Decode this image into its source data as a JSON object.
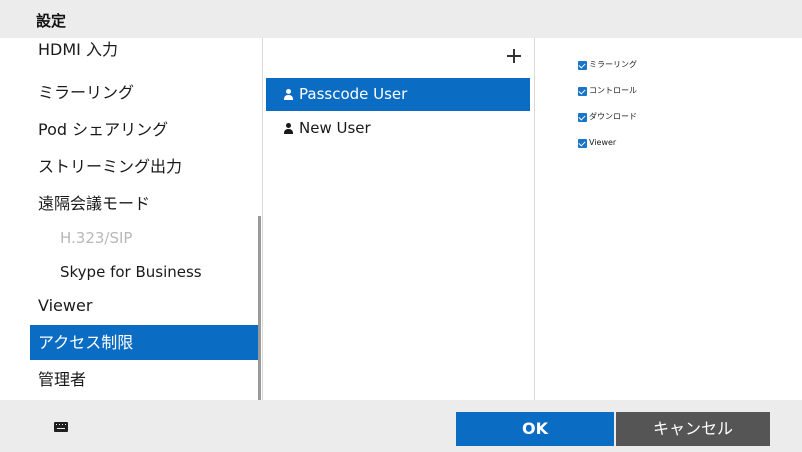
{
  "window": {
    "title": "設定"
  },
  "menu": {
    "items": [
      {
        "label": "HDMI 入力",
        "state": "normal"
      },
      {
        "label": "ミラーリング",
        "state": "normal"
      },
      {
        "label": "Pod シェアリング",
        "state": "normal"
      },
      {
        "label": "ストリーミング出力",
        "state": "normal"
      },
      {
        "label": "遠隔会議モード",
        "state": "normal"
      },
      {
        "label": "H.323/SIP",
        "state": "disabled"
      },
      {
        "label": "Skype for Business",
        "state": "sub"
      },
      {
        "label": "Viewer",
        "state": "normal"
      },
      {
        "label": "アクセス制限",
        "state": "selected"
      },
      {
        "label": "管理者",
        "state": "normal"
      }
    ]
  },
  "users": {
    "add_icon": "plus-icon",
    "items": [
      {
        "label": "Passcode User",
        "selected": true,
        "icon": "person-icon"
      },
      {
        "label": "New User",
        "selected": false,
        "icon": "person-icon"
      }
    ]
  },
  "permissions": {
    "items": [
      {
        "label": "ミラーリング",
        "checked": true
      },
      {
        "label": "コントロール",
        "checked": true
      },
      {
        "label": "ダウンロード",
        "checked": true
      },
      {
        "label": "Viewer",
        "checked": true
      }
    ]
  },
  "footer": {
    "keyboard_icon": "keyboard-icon",
    "ok_label": "OK",
    "cancel_label": "キャンセル"
  },
  "colors": {
    "accent": "#0b6cc4",
    "bar_background": "#ececec",
    "cancel_button": "#555555"
  }
}
